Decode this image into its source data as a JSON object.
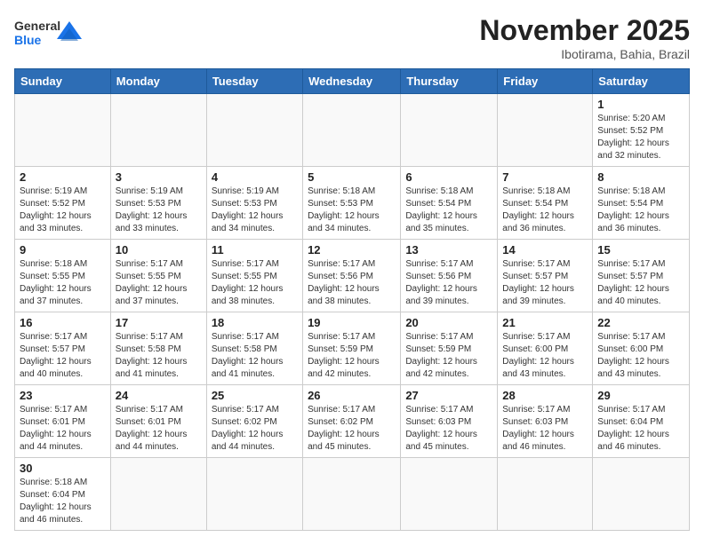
{
  "header": {
    "logo": {
      "general": "General",
      "blue": "Blue"
    },
    "title": "November 2025",
    "subtitle": "Ibotirama, Bahia, Brazil"
  },
  "weekdays": [
    "Sunday",
    "Monday",
    "Tuesday",
    "Wednesday",
    "Thursday",
    "Friday",
    "Saturday"
  ],
  "weeks": [
    [
      {
        "day": "",
        "info": ""
      },
      {
        "day": "",
        "info": ""
      },
      {
        "day": "",
        "info": ""
      },
      {
        "day": "",
        "info": ""
      },
      {
        "day": "",
        "info": ""
      },
      {
        "day": "",
        "info": ""
      },
      {
        "day": "1",
        "info": "Sunrise: 5:20 AM\nSunset: 5:52 PM\nDaylight: 12 hours and 32 minutes."
      }
    ],
    [
      {
        "day": "2",
        "info": "Sunrise: 5:19 AM\nSunset: 5:52 PM\nDaylight: 12 hours and 33 minutes."
      },
      {
        "day": "3",
        "info": "Sunrise: 5:19 AM\nSunset: 5:53 PM\nDaylight: 12 hours and 33 minutes."
      },
      {
        "day": "4",
        "info": "Sunrise: 5:19 AM\nSunset: 5:53 PM\nDaylight: 12 hours and 34 minutes."
      },
      {
        "day": "5",
        "info": "Sunrise: 5:18 AM\nSunset: 5:53 PM\nDaylight: 12 hours and 34 minutes."
      },
      {
        "day": "6",
        "info": "Sunrise: 5:18 AM\nSunset: 5:54 PM\nDaylight: 12 hours and 35 minutes."
      },
      {
        "day": "7",
        "info": "Sunrise: 5:18 AM\nSunset: 5:54 PM\nDaylight: 12 hours and 36 minutes."
      },
      {
        "day": "8",
        "info": "Sunrise: 5:18 AM\nSunset: 5:54 PM\nDaylight: 12 hours and 36 minutes."
      }
    ],
    [
      {
        "day": "9",
        "info": "Sunrise: 5:18 AM\nSunset: 5:55 PM\nDaylight: 12 hours and 37 minutes."
      },
      {
        "day": "10",
        "info": "Sunrise: 5:17 AM\nSunset: 5:55 PM\nDaylight: 12 hours and 37 minutes."
      },
      {
        "day": "11",
        "info": "Sunrise: 5:17 AM\nSunset: 5:55 PM\nDaylight: 12 hours and 38 minutes."
      },
      {
        "day": "12",
        "info": "Sunrise: 5:17 AM\nSunset: 5:56 PM\nDaylight: 12 hours and 38 minutes."
      },
      {
        "day": "13",
        "info": "Sunrise: 5:17 AM\nSunset: 5:56 PM\nDaylight: 12 hours and 39 minutes."
      },
      {
        "day": "14",
        "info": "Sunrise: 5:17 AM\nSunset: 5:57 PM\nDaylight: 12 hours and 39 minutes."
      },
      {
        "day": "15",
        "info": "Sunrise: 5:17 AM\nSunset: 5:57 PM\nDaylight: 12 hours and 40 minutes."
      }
    ],
    [
      {
        "day": "16",
        "info": "Sunrise: 5:17 AM\nSunset: 5:57 PM\nDaylight: 12 hours and 40 minutes."
      },
      {
        "day": "17",
        "info": "Sunrise: 5:17 AM\nSunset: 5:58 PM\nDaylight: 12 hours and 41 minutes."
      },
      {
        "day": "18",
        "info": "Sunrise: 5:17 AM\nSunset: 5:58 PM\nDaylight: 12 hours and 41 minutes."
      },
      {
        "day": "19",
        "info": "Sunrise: 5:17 AM\nSunset: 5:59 PM\nDaylight: 12 hours and 42 minutes."
      },
      {
        "day": "20",
        "info": "Sunrise: 5:17 AM\nSunset: 5:59 PM\nDaylight: 12 hours and 42 minutes."
      },
      {
        "day": "21",
        "info": "Sunrise: 5:17 AM\nSunset: 6:00 PM\nDaylight: 12 hours and 43 minutes."
      },
      {
        "day": "22",
        "info": "Sunrise: 5:17 AM\nSunset: 6:00 PM\nDaylight: 12 hours and 43 minutes."
      }
    ],
    [
      {
        "day": "23",
        "info": "Sunrise: 5:17 AM\nSunset: 6:01 PM\nDaylight: 12 hours and 44 minutes."
      },
      {
        "day": "24",
        "info": "Sunrise: 5:17 AM\nSunset: 6:01 PM\nDaylight: 12 hours and 44 minutes."
      },
      {
        "day": "25",
        "info": "Sunrise: 5:17 AM\nSunset: 6:02 PM\nDaylight: 12 hours and 44 minutes."
      },
      {
        "day": "26",
        "info": "Sunrise: 5:17 AM\nSunset: 6:02 PM\nDaylight: 12 hours and 45 minutes."
      },
      {
        "day": "27",
        "info": "Sunrise: 5:17 AM\nSunset: 6:03 PM\nDaylight: 12 hours and 45 minutes."
      },
      {
        "day": "28",
        "info": "Sunrise: 5:17 AM\nSunset: 6:03 PM\nDaylight: 12 hours and 46 minutes."
      },
      {
        "day": "29",
        "info": "Sunrise: 5:17 AM\nSunset: 6:04 PM\nDaylight: 12 hours and 46 minutes."
      }
    ],
    [
      {
        "day": "30",
        "info": "Sunrise: 5:18 AM\nSunset: 6:04 PM\nDaylight: 12 hours and 46 minutes."
      },
      {
        "day": "",
        "info": ""
      },
      {
        "day": "",
        "info": ""
      },
      {
        "day": "",
        "info": ""
      },
      {
        "day": "",
        "info": ""
      },
      {
        "day": "",
        "info": ""
      },
      {
        "day": "",
        "info": ""
      }
    ]
  ]
}
